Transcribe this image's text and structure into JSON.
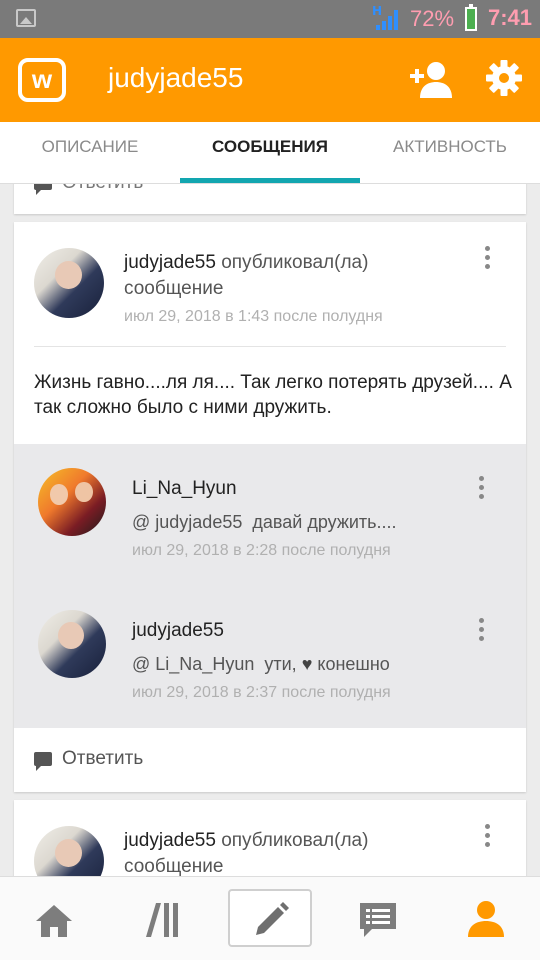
{
  "status_bar": {
    "network": "H",
    "battery": "72%",
    "time": "7:41"
  },
  "app_bar": {
    "logo": "w",
    "title": "judyjade55"
  },
  "tabs": [
    {
      "label": "ОПИСАНИЕ",
      "active": false
    },
    {
      "label": "СООБЩЕНИЯ",
      "active": true
    },
    {
      "label": "АКТИВНОСТЬ",
      "active": false
    }
  ],
  "feed": {
    "prev_reply_label": "Ответить",
    "post": {
      "author": "judyjade55",
      "action": "опубликовал(ла)",
      "kind": "сообщение",
      "time": "июл 29, 2018 в 1:43 после полудня",
      "text": "Жизнь гавно....ля ля.... Так легко потерять друзей.... А так сложно было с ними дружить.",
      "comments": [
        {
          "author": "Li_Na_Hyun",
          "mention": "@ judyjade55",
          "text": "давай дружить....",
          "time": "июл 29, 2018 в 2:28 после полудня"
        },
        {
          "author": "judyjade55",
          "mention": "@ Li_Na_Hyun",
          "text_before": "ути,",
          "heart": "♥",
          "text_after": "конешно",
          "time": "июл 29, 2018 в 2:37 после полудня"
        }
      ],
      "reply_label": "Ответить"
    },
    "next_post": {
      "author": "judyjade55",
      "action": "опубликовал(ла)",
      "kind": "сообщение"
    }
  },
  "bottom_nav": [
    {
      "icon": "home-icon"
    },
    {
      "icon": "library-icon"
    },
    {
      "icon": "pencil-icon"
    },
    {
      "icon": "messages-icon"
    },
    {
      "icon": "profile-icon",
      "active": true
    }
  ],
  "colors": {
    "accent": "#ff9900",
    "tab_indicator": "#12a6b0",
    "status_text": "#ff9db0"
  }
}
